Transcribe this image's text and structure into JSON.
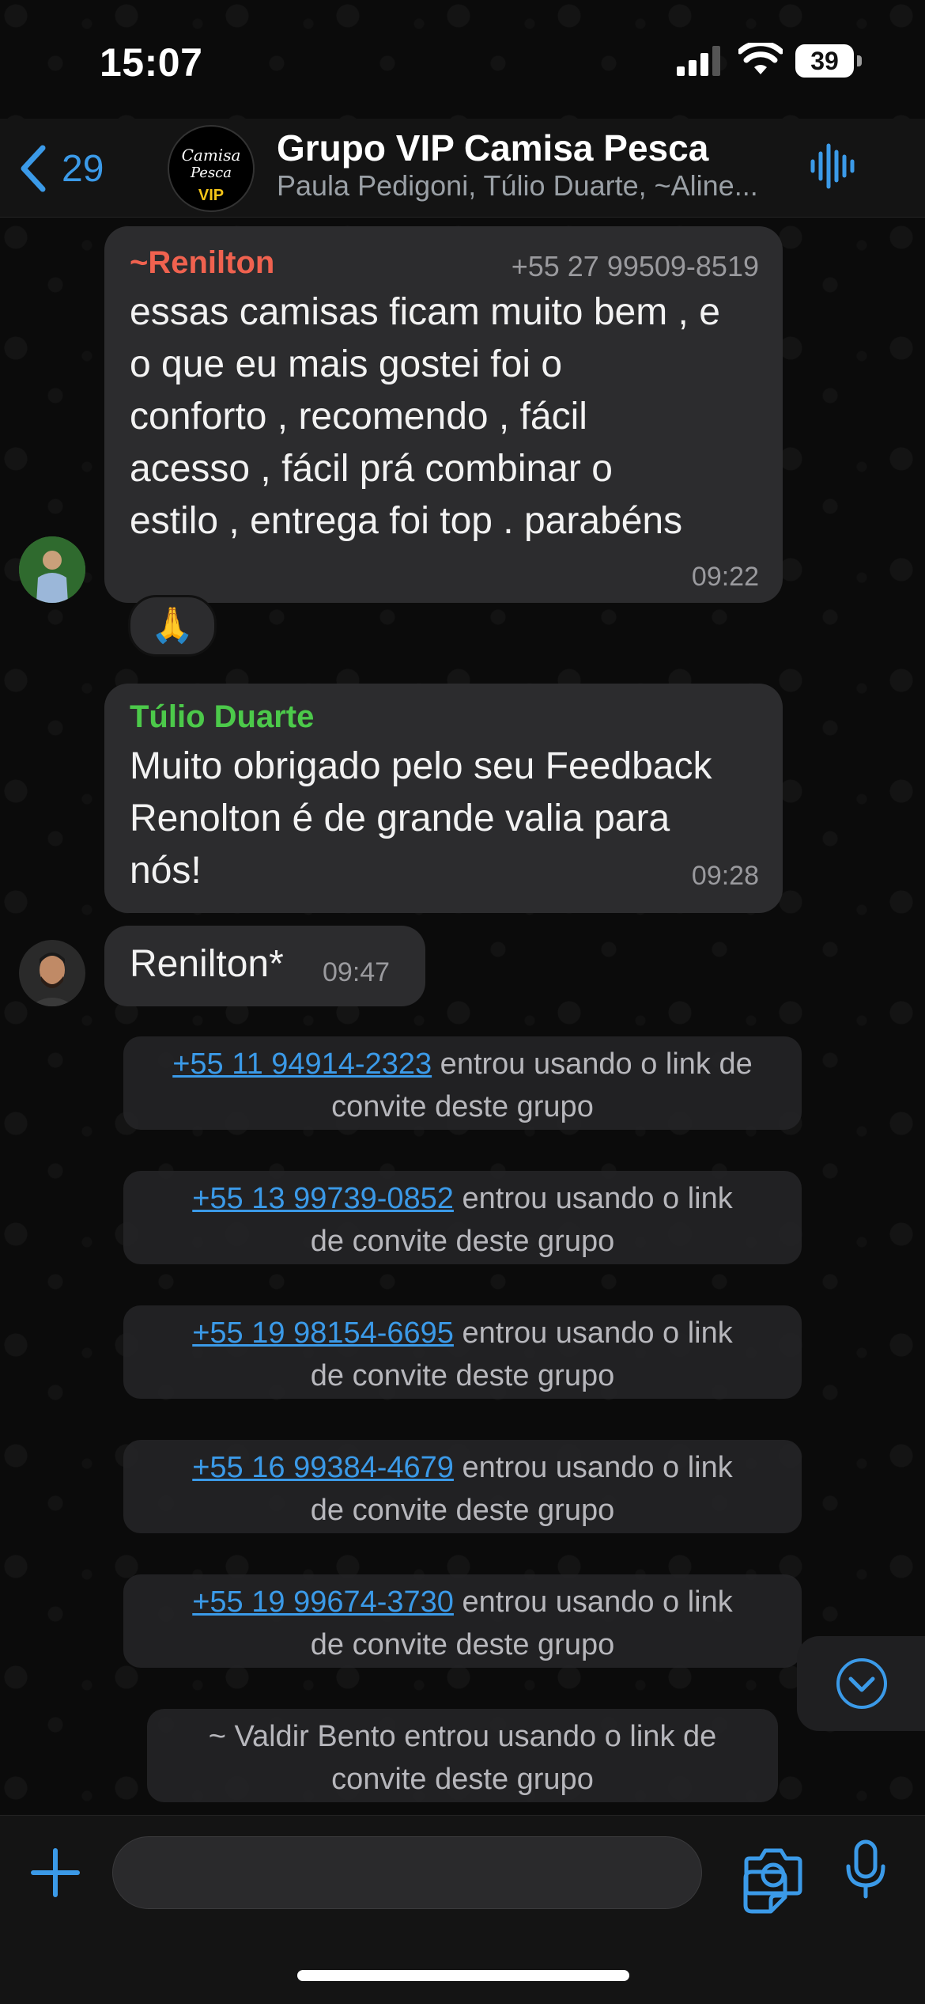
{
  "status_bar": {
    "time": "15:07",
    "battery_level": "39"
  },
  "header": {
    "back_count": "29",
    "group_name": "Grupo VIP Camisa Pesca",
    "members": "Paula Pedigoni, Túlio Duarte, ~Aline...",
    "avatar_text": {
      "line1": "Camisa",
      "line2": "Pesca",
      "line3": "VIP"
    },
    "icons": {
      "back": "chevron-left-icon",
      "voice_chat": "waveform-icon"
    }
  },
  "messages": [
    {
      "sender": "~Renilton",
      "sender_color": "#f0624f",
      "phone": "+55 27 99509-8519",
      "text_lines": [
        "essas camisas ficam muito bem , e",
        "o que eu mais gostei foi o",
        "conforto , recomendo , fácil",
        "acesso , fácil prá combinar o",
        "estilo ,  entrega foi top . parabéns"
      ],
      "time": "09:22",
      "reaction": "🙏"
    },
    {
      "sender": "Túlio Duarte",
      "sender_color": "#4cc94a",
      "text_lines": [
        "Muito obrigado pelo seu Feedback",
        "Renolton é de grande valia para",
        "nós!"
      ],
      "time": "09:28"
    },
    {
      "text": "Renilton*",
      "time": "09:47"
    }
  ],
  "system_messages": [
    {
      "phone": "+55 11 94914-2323",
      "line1_rest": " entrou usando o link de",
      "line2": "convite deste grupo"
    },
    {
      "phone": "+55 13 99739-0852",
      "line1_rest": " entrou usando o link",
      "line2": "de convite deste grupo"
    },
    {
      "phone": "+55 19 98154-6695",
      "line1_rest": " entrou usando o link",
      "line2": "de convite deste grupo"
    },
    {
      "phone": "+55 16 99384-4679",
      "line1_rest": " entrou usando o link",
      "line2": "de convite deste grupo"
    },
    {
      "phone": "+55 19 99674-3730",
      "line1_rest": " entrou usando o link",
      "line2": "de convite deste grupo"
    },
    {
      "line1": "~ Valdir Bento entrou usando o link de",
      "line2": "convite deste grupo"
    }
  ],
  "composer": {
    "value": "",
    "icons": {
      "add": "plus-icon",
      "sticker": "sticker-icon",
      "camera": "camera-icon",
      "mic": "microphone-icon"
    }
  },
  "colors": {
    "accent": "#3b9ae8",
    "bubble": "#2c2c2e",
    "background": "#0b0b0b"
  }
}
